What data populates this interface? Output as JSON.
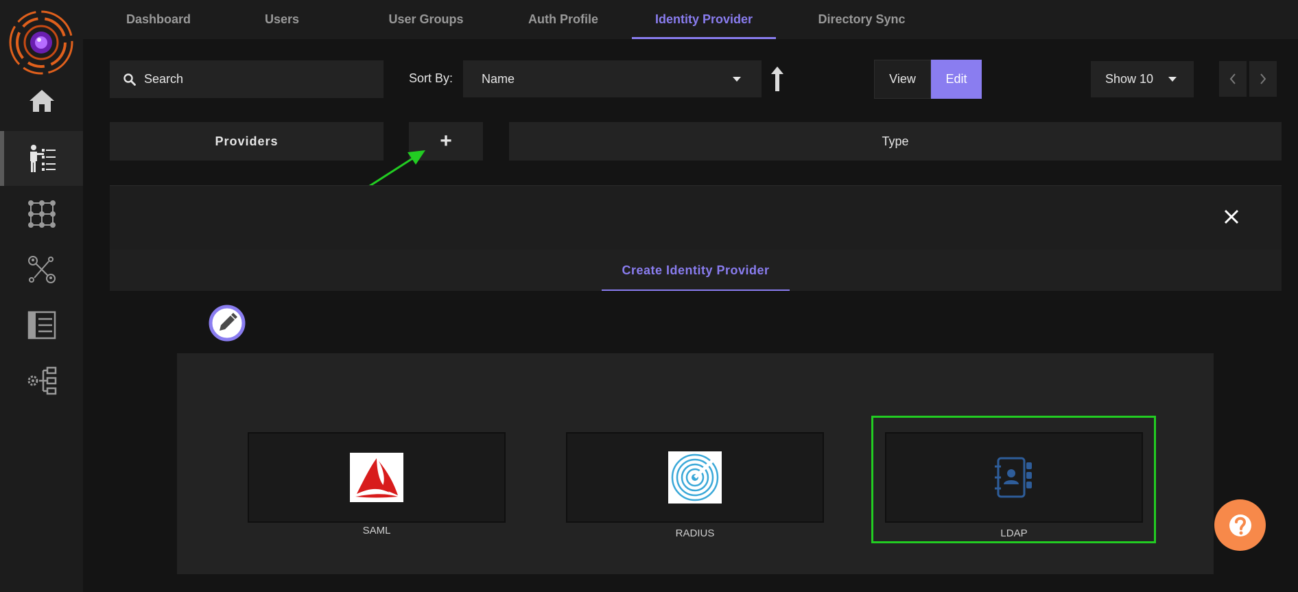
{
  "nav": {
    "tabs": [
      {
        "label": "Dashboard"
      },
      {
        "label": "Users"
      },
      {
        "label": "User Groups"
      },
      {
        "label": "Auth Profile"
      },
      {
        "label": "Identity Provider",
        "active": true
      },
      {
        "label": "Directory Sync"
      }
    ]
  },
  "sidebar": {
    "items": [
      {
        "icon": "home-icon"
      },
      {
        "icon": "identity-list-icon",
        "active": true
      },
      {
        "icon": "grid-network-icon"
      },
      {
        "icon": "user-connections-icon"
      },
      {
        "icon": "records-icon"
      },
      {
        "icon": "settings-tree-icon"
      }
    ]
  },
  "toolbar": {
    "search_placeholder": "Search",
    "sort_label": "Sort By:",
    "sort_value": "Name",
    "view_label": "View",
    "edit_label": "Edit",
    "show_value": "Show 10"
  },
  "table": {
    "providers_header": "Providers",
    "add_label": "+",
    "type_header": "Type"
  },
  "panel": {
    "tab_label": "Create Identity Provider",
    "cards": [
      {
        "label": "SAML",
        "icon": "saml-logo-icon"
      },
      {
        "label": "RADIUS",
        "icon": "radius-logo-icon"
      },
      {
        "label": "LDAP",
        "icon": "ldap-address-book-icon",
        "highlighted": true
      }
    ]
  },
  "colors": {
    "accent": "#8a7df0",
    "highlight": "#22cc22",
    "help": "#f7894a"
  }
}
